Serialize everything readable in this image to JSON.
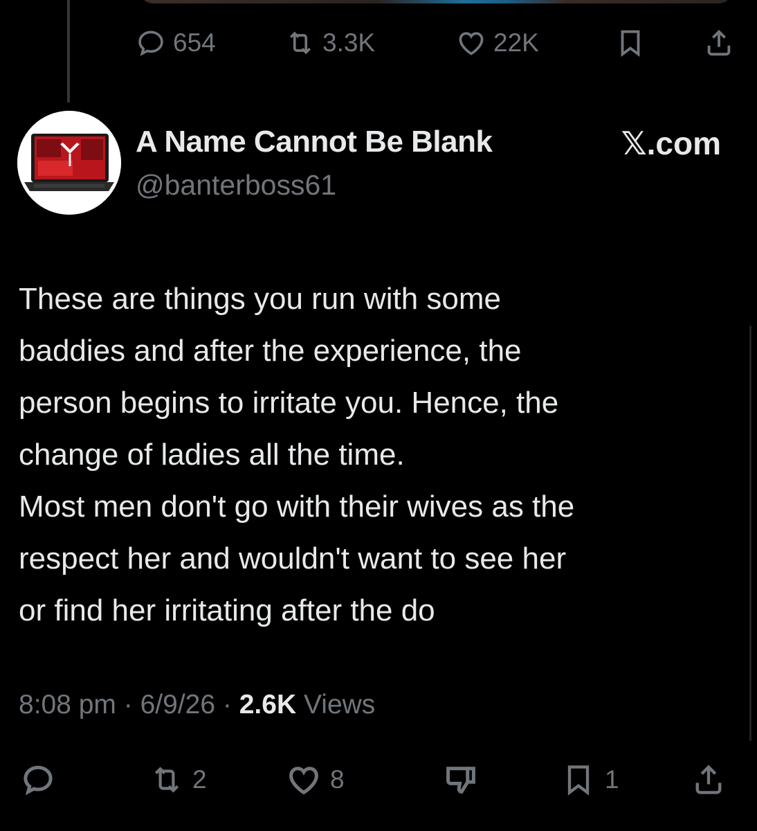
{
  "previous_tweet": {
    "actions": {
      "replies": "654",
      "reposts": "3.3K",
      "likes": "22K"
    }
  },
  "tweet": {
    "author": {
      "display_name": "A Name Cannot Be Blank",
      "handle": "@banterboss61"
    },
    "watermark": "𝕏.com",
    "text_lines": [
      "These are things you run with some",
      "baddies and after the experience,  the",
      "person begins to irritate you. Hence, the",
      "change of ladies all the time.",
      "Most men don't go with their wives as the",
      "respect her and wouldn't want to see her",
      "or find her irritating after the do"
    ],
    "meta": {
      "time": "8:08 pm",
      "sep1": "·",
      "date": "6/9/26",
      "sep2": "·",
      "views_count": "2.6K",
      "views_label": "Views"
    },
    "actions": {
      "reposts": "2",
      "likes": "8",
      "bookmarks": "1"
    }
  },
  "icons": [
    "reply-icon",
    "repost-icon",
    "like-icon",
    "bookmark-icon",
    "share-icon",
    "dislike-icon"
  ],
  "colors": {
    "background": "#000000",
    "text_primary": "#e7e9ea",
    "text_secondary": "#71767b"
  }
}
